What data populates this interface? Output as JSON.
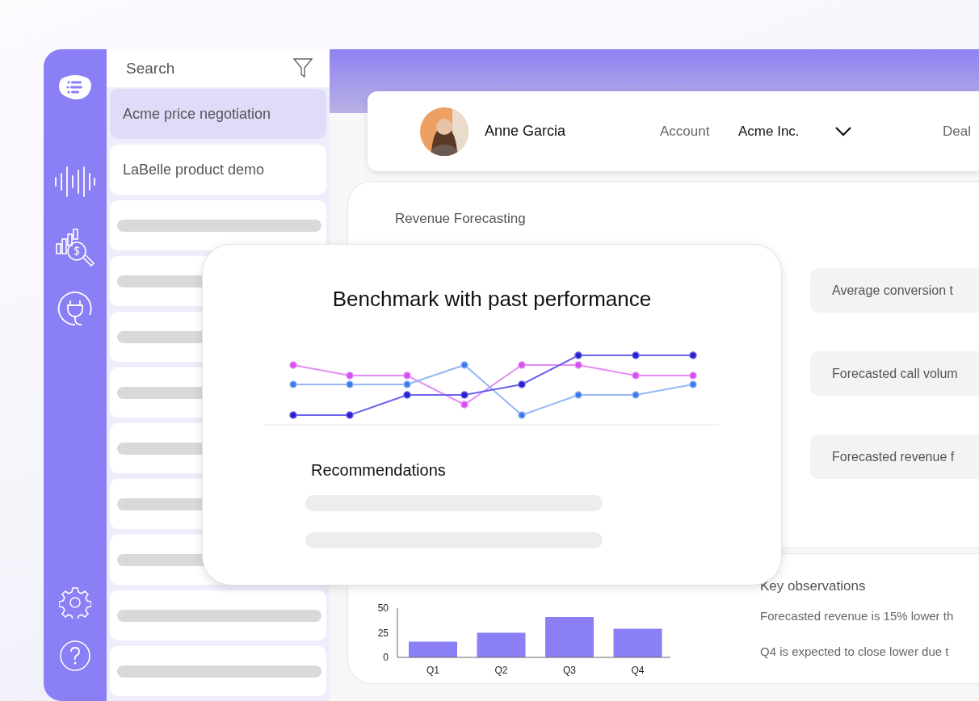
{
  "sidebar": {
    "search": {
      "placeholder": "Search"
    },
    "items": [
      {
        "kind": "text",
        "label": "Acme price negotiation",
        "selected": true
      },
      {
        "kind": "text",
        "label": "LaBelle product demo",
        "selected": false
      },
      {
        "kind": "skeleton",
        "selected": false
      },
      {
        "kind": "skeleton",
        "selected": false
      },
      {
        "kind": "skeleton",
        "selected": false
      },
      {
        "kind": "skeleton",
        "selected": false
      },
      {
        "kind": "skeleton",
        "selected": false
      },
      {
        "kind": "skeleton",
        "selected": false
      },
      {
        "kind": "skeleton",
        "selected": false
      },
      {
        "kind": "skeleton",
        "selected": false
      },
      {
        "kind": "skeleton",
        "selected": false
      }
    ]
  },
  "header": {
    "name": "Anne Garcia",
    "account_label": "Account",
    "account_value": "Acme Inc.",
    "deal_label": "Deal"
  },
  "revenue_forecasting": {
    "title": "Revenue Forecasting",
    "metrics": [
      "Average conversion t",
      "Forecasted call volum",
      "Forecasted revenue f"
    ]
  },
  "growth_chart": {
    "chart_data": {
      "type": "bar",
      "categories": [
        "Q1",
        "Q2",
        "Q3",
        "Q4"
      ],
      "values": [
        16,
        25,
        41,
        29
      ],
      "ylim": [
        0,
        50
      ],
      "yticks": [
        0,
        25,
        50
      ]
    }
  },
  "key_observations": {
    "title": "Key observations",
    "items": [
      "Forecasted revenue is 15% lower th",
      "Q4 is expected to close lower due t"
    ]
  },
  "popup": {
    "title": "Benchmark with past performance",
    "recommendations_title": "Recommendations"
  }
}
